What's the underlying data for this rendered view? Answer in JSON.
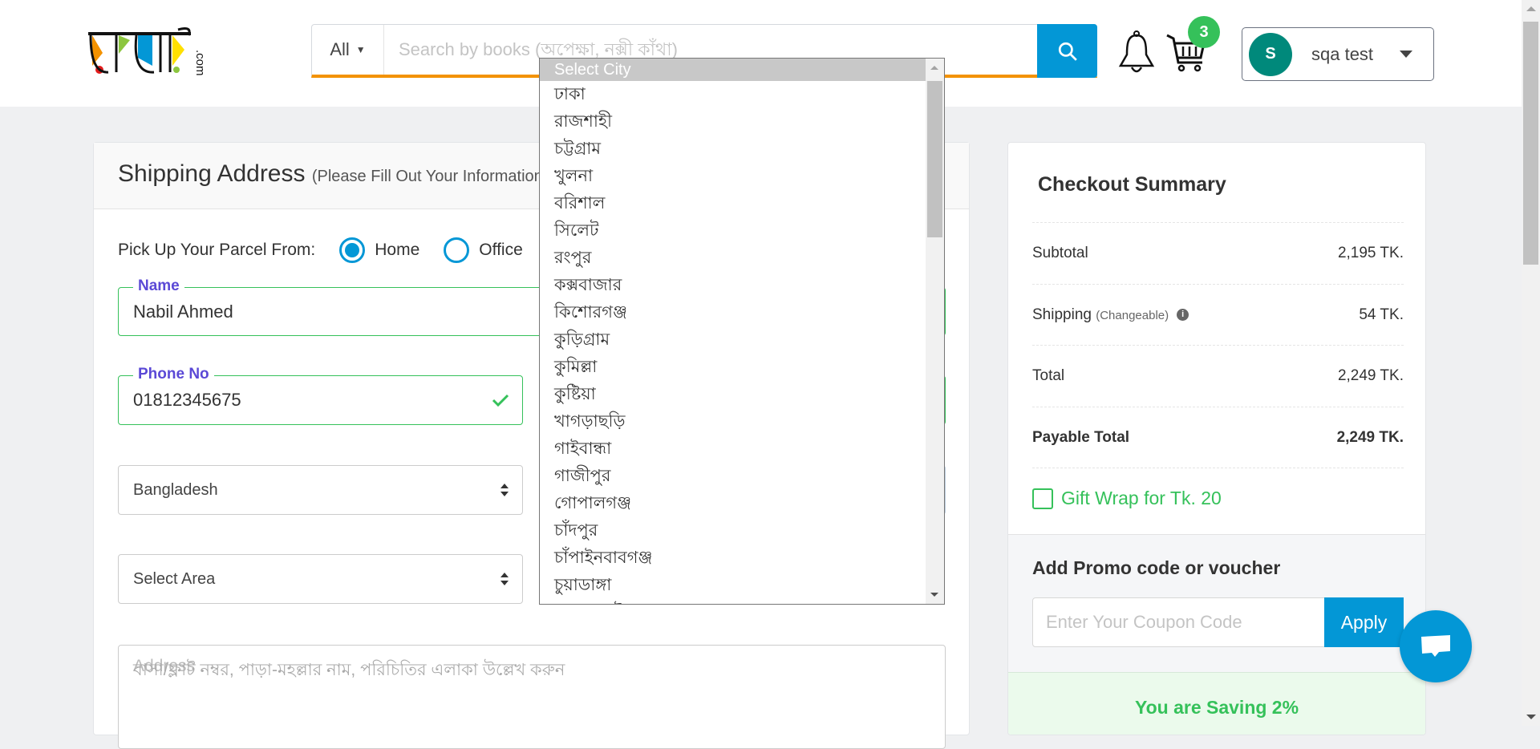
{
  "header": {
    "search_category": "All",
    "search_placeholder": "Search by books (অপেক্ষা, নক্সী কাঁথা)",
    "cart_count": "3",
    "user_initial": "S",
    "user_name": "sqa test",
    "logo_text": "রকমারি.com"
  },
  "shipping": {
    "title": "Shipping Address",
    "subtitle": "(Please Fill Out Your Information)",
    "pickup_label": "Pick Up Your Parcel From:",
    "pickup_options": [
      "Home",
      "Office"
    ],
    "name_label": "Name",
    "name_value": "Nabil Ahmed",
    "phone_label": "Phone No",
    "phone_value": "01812345675",
    "country_value": "Bangladesh",
    "area_value": "Select Area",
    "address_label": "Address",
    "address_placeholder": "বাসা/ফ্লাট নম্বর, পাড়া-মহল্লার নাম, পরিচিতির এলাকা উল্লেখ করুন"
  },
  "city_dropdown": {
    "selected": "Select City",
    "options": [
      "ঢাকা",
      "রাজশাহী",
      "চট্টগ্রাম",
      "খুলনা",
      "বরিশাল",
      "সিলেট",
      "রংপুর",
      "কক্সবাজার",
      "কিশোরগঞ্জ",
      "কুড়িগ্রাম",
      "কুমিল্লা",
      "কুষ্টিয়া",
      "খাগড়াছড়ি",
      "গাইবান্ধা",
      "গাজীপুর",
      "গোপালগঞ্জ",
      "চাঁদপুর",
      "চাঁপাইনবাবগঞ্জ",
      "চুয়াডাঙ্গা",
      "জয়পুরহাট"
    ]
  },
  "summary": {
    "title": "Checkout Summary",
    "subtotal_label": "Subtotal",
    "subtotal_value": "2,195 TK.",
    "shipping_label": "Shipping",
    "shipping_note": "(Changeable)",
    "shipping_value": "54 TK.",
    "total_label": "Total",
    "total_value": "2,249 TK.",
    "payable_label": "Payable Total",
    "payable_value": "2,249 TK.",
    "gift_wrap": "Gift Wrap for Tk. 20",
    "promo_title": "Add Promo code or voucher",
    "coupon_placeholder": "Enter Your Coupon Code",
    "apply": "Apply",
    "saving": "You are Saving 2%"
  },
  "colors": {
    "accent": "#0397d6",
    "success": "#35c15a",
    "orange": "#f39200",
    "label": "#5b49d6"
  }
}
